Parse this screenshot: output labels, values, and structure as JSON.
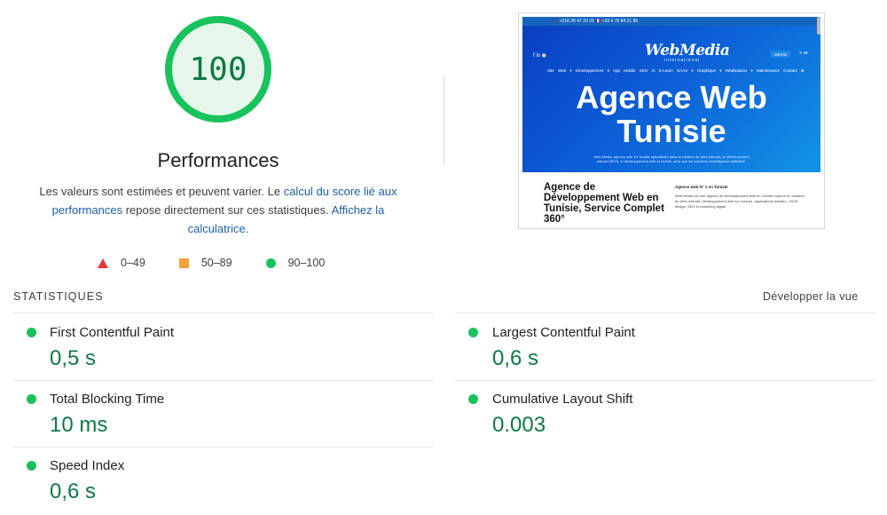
{
  "score": {
    "value": "100",
    "title": "Performances",
    "color": "#0c7a43",
    "ring_color": "#18c25d",
    "fill_color": "#e6f6ea"
  },
  "description": {
    "part1": "Les valeurs sont estimées et peuvent varier. Le ",
    "link1": "calcul du score lié aux performances",
    "part2": " repose directement sur ces statistiques. ",
    "link2": "Affichez la calculatrice",
    "part3": "."
  },
  "legend": [
    {
      "range": "0–49",
      "shape": "triangle-icon",
      "color": "#e53935"
    },
    {
      "range": "50–89",
      "shape": "square-icon",
      "color": "#f4a534"
    },
    {
      "range": "90–100",
      "shape": "circle-icon",
      "color": "#18c25d"
    }
  ],
  "thumbnail": {
    "topinfo": "📞 +216 28 47 20 29      🇫🇷 +33 4 76 84 21 86",
    "social": "f  in  ◉",
    "logo": "WebMedia",
    "logo_sub": "international",
    "devis": "DEVIS",
    "icons": "⌕  ☰",
    "nav": "Site Web ▾  Développement ▾  App Mobile  SEO  IA  E-Learn  NAAS ▾  Graphique ▾  Réalisations ▾  Maintenance  Contact  ⊕",
    "headline_line1": "Agence Web",
    "headline_line2": "Tunisie",
    "hero_text": "Web Media, agence web en Tunisie spécialisée dans la création de sites internet, le référencement naturel (SEO), le développement web et mobile, ainsi que les solutions d'intelligence artificielle.",
    "section_title": "Agence de Développement Web en Tunisie, Service Complet 360°",
    "side_title": "Agence web N° 1 en Tunisie",
    "side_body": "Web Media est une agence de développement web en Tunisie experte en création de sites internet, développement web sur mesure, applications mobiles, UX/UI design, SEO et marketing digital."
  },
  "stats": {
    "heading": "STATISTIQUES",
    "expand_label": "Développer la vue",
    "metrics": [
      {
        "label": "First Contentful Paint",
        "value": "0,5 s"
      },
      {
        "label": "Largest Contentful Paint",
        "value": "0,6 s"
      },
      {
        "label": "Total Blocking Time",
        "value": "10 ms"
      },
      {
        "label": "Cumulative Layout Shift",
        "value": "0.003"
      },
      {
        "label": "Speed Index",
        "value": "0,6 s"
      }
    ]
  }
}
